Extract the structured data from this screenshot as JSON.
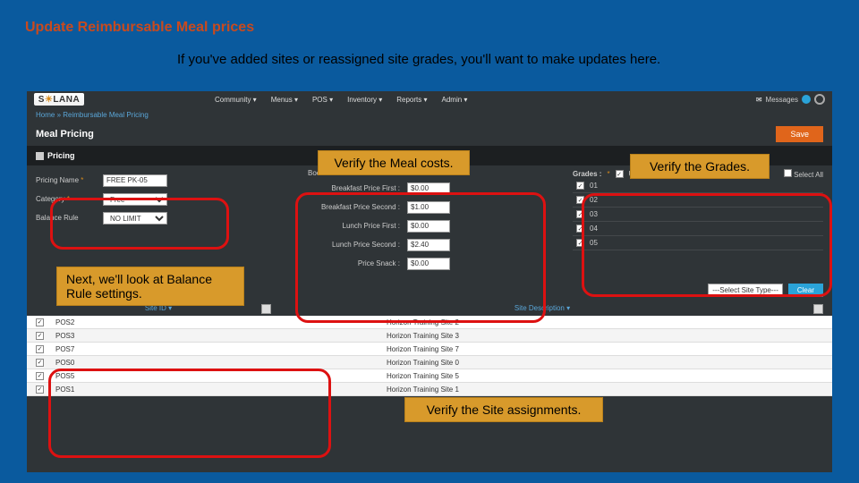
{
  "slide": {
    "title": "Update Reimbursable Meal prices",
    "subtitle": "If you've added sites or reassigned site grades, you'll want to make updates here."
  },
  "callouts": {
    "costs": "Verify the Meal costs.",
    "grades": "Verify the Grades.",
    "balance": "Next, we'll look at Balance Rule settings.",
    "sites": "Verify the Site assignments."
  },
  "app": {
    "logo_pre": "S",
    "logo_sun": "☀",
    "logo_post": "LANA",
    "menu": [
      "Community ▾",
      "Menus ▾",
      "POS ▾",
      "Inventory ▾",
      "Reports ▾",
      "Admin ▾"
    ],
    "messages": "Messages",
    "breadcrumb": "Home » Reimbursable Meal Pricing",
    "page_title": "Meal Pricing",
    "save": "Save",
    "section_pricing": "Pricing",
    "section_second": "Book Second Meals",
    "left": {
      "pricing_name_lbl": "Pricing Name ",
      "pricing_name_val": "FREE PK-05",
      "category_lbl": "Category ",
      "category_val": "Free",
      "balance_lbl": "Balance Rule",
      "balance_val": "NO LIMIT"
    },
    "mid": {
      "bf_first_lbl": "Breakfast Price First :",
      "bf_first_val": "$0.00",
      "bf_second_lbl": "Breakfast Price Second :",
      "bf_second_val": "$1.00",
      "ln_first_lbl": "Lunch Price First :",
      "ln_first_val": "$0.00",
      "ln_second_lbl": "Lunch Price Second :",
      "ln_second_val": "$2.40",
      "snack_lbl": "Price Snack :",
      "snack_val": "$0.00"
    },
    "gr": {
      "label": "Grades :",
      "daily": "Use for Daily Entry",
      "select_all": "Select All",
      "items": [
        "01",
        "02",
        "03",
        "04",
        "05"
      ]
    },
    "site_type": "---Select Site Type---",
    "clear": "Clear",
    "th_site": "Site ID ▾",
    "th_desc": "Site Description ▾",
    "rows": [
      {
        "id": "POS2",
        "desc": "Horizon Training Site 2"
      },
      {
        "id": "POS3",
        "desc": "Horizon Training Site 3"
      },
      {
        "id": "POS7",
        "desc": "Horizon Training Site 7"
      },
      {
        "id": "POS0",
        "desc": "Horizon Training Site 0"
      },
      {
        "id": "POS5",
        "desc": "Horizon Training Site 5"
      },
      {
        "id": "POS1",
        "desc": "Horizon Training Site 1"
      }
    ]
  }
}
